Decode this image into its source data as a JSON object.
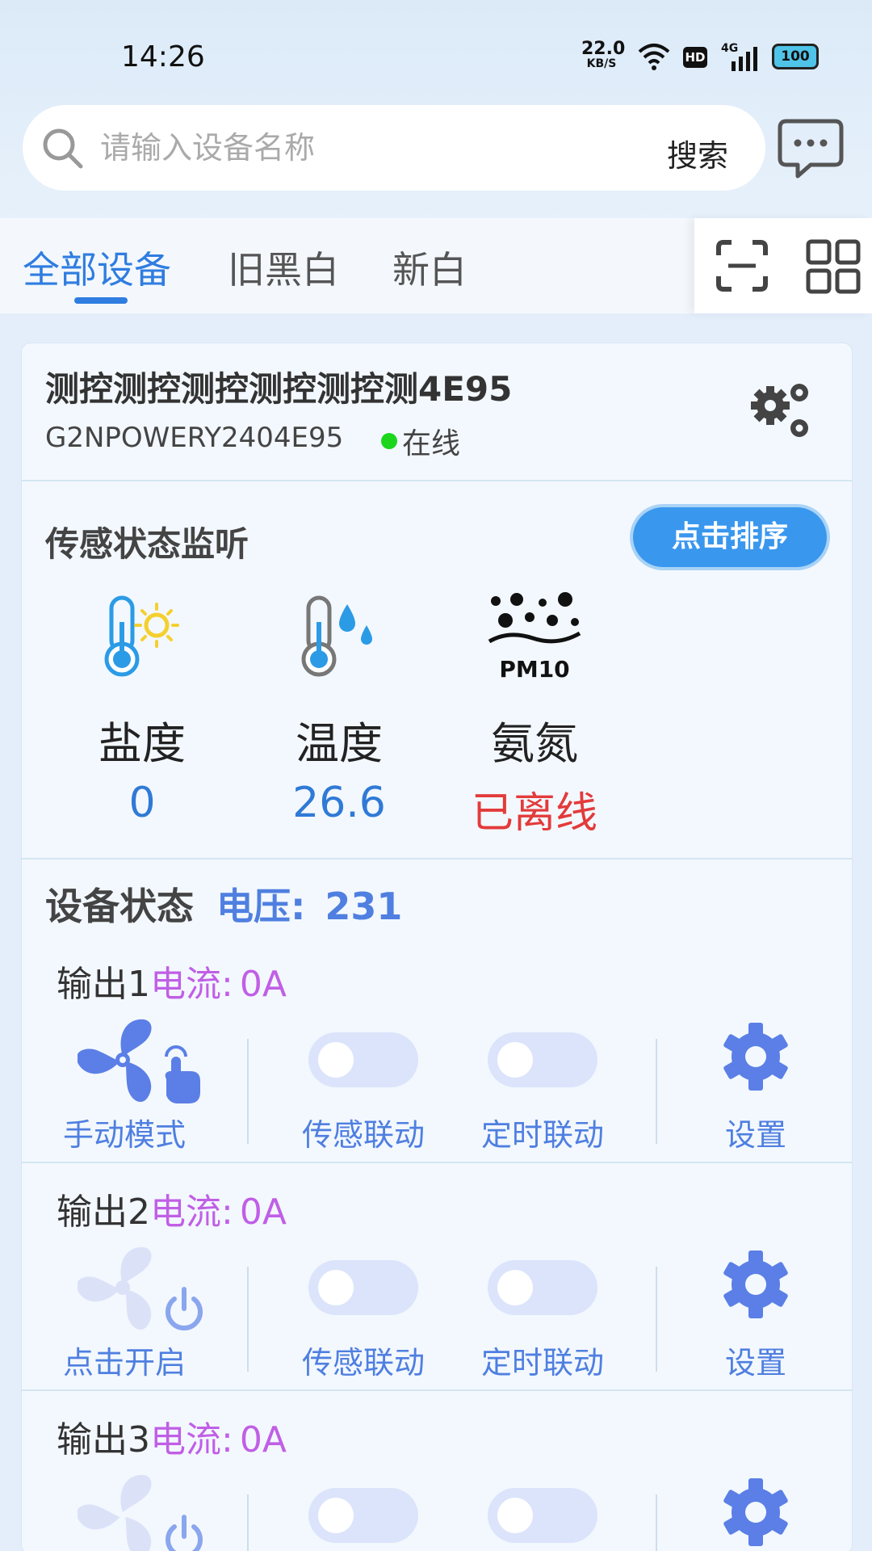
{
  "status_bar": {
    "time": "14:26",
    "speed_value": "22.0",
    "speed_unit": "KB/S",
    "hd": "HD",
    "network": "4G",
    "battery": "100"
  },
  "search": {
    "placeholder": "请输入设备名称",
    "button_label": "搜索"
  },
  "tabs": [
    {
      "label": "全部设备",
      "active": true
    },
    {
      "label": "旧黑白",
      "active": false
    },
    {
      "label": "新白",
      "active": false
    }
  ],
  "device": {
    "name": "测控测控测控测控测控测4E95",
    "id": "G2NPOWERY2404E95",
    "status": "在线"
  },
  "sensors": {
    "title": "传感状态监听",
    "sort_button": "点击排序",
    "items": [
      {
        "name": "盐度",
        "value": "0",
        "color": "#2f7ad6"
      },
      {
        "name": "温度",
        "value": "26.6",
        "color": "#2f7ad6"
      },
      {
        "name": "氨氮",
        "value": "已离线",
        "color": "#e33b3b",
        "icon_text": "PM10"
      }
    ]
  },
  "device_status": {
    "label": "设备状态",
    "voltage_label": "电压:",
    "voltage_value": "231"
  },
  "outputs": [
    {
      "label": "输出1",
      "current_label": "电流:",
      "current_value": "0A",
      "mode_label": "手动模式",
      "mode_active": true,
      "sensor_link": "传感联动",
      "timer_link": "定时联动",
      "settings": "设置"
    },
    {
      "label": "输出2",
      "current_label": "电流:",
      "current_value": "0A",
      "mode_label": "点击开启",
      "mode_active": false,
      "sensor_link": "传感联动",
      "timer_link": "定时联动",
      "settings": "设置"
    },
    {
      "label": "输出3",
      "current_label": "电流:",
      "current_value": "0A"
    }
  ],
  "colors": {
    "accent": "#2f7de0",
    "link_blue": "#4f7fe0",
    "current_purple": "#c05fe6",
    "online_green": "#1cd61c",
    "offline_red": "#e33b3b"
  }
}
